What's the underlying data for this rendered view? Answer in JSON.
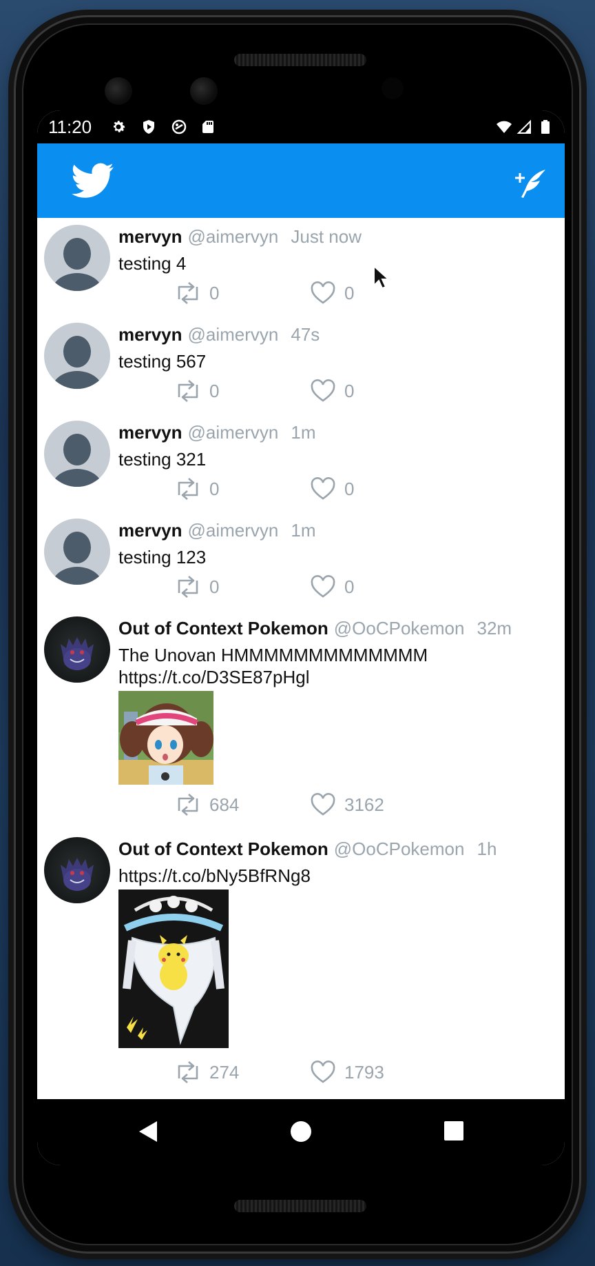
{
  "status_bar": {
    "time": "11:20",
    "left_icons": [
      "settings-icon",
      "shield-icon",
      "sync-icon",
      "sd-card-icon"
    ],
    "right_icons": [
      "wifi-icon",
      "signal-icon",
      "battery-icon"
    ]
  },
  "app_bar": {
    "logo": "twitter-bird-icon",
    "compose_icon": "compose-tweet-icon",
    "color": "#0a8ef0"
  },
  "tweets": [
    {
      "name": "mervyn",
      "handle": "@aimervyn",
      "time": "Just now",
      "text": "testing 4",
      "retweets": "0",
      "likes": "0",
      "avatar": "default"
    },
    {
      "name": "mervyn",
      "handle": "@aimervyn",
      "time": "47s",
      "text": "testing 567",
      "retweets": "0",
      "likes": "0",
      "avatar": "default"
    },
    {
      "name": "mervyn",
      "handle": "@aimervyn",
      "time": "1m",
      "text": "testing 321",
      "retweets": "0",
      "likes": "0",
      "avatar": "default"
    },
    {
      "name": "mervyn",
      "handle": "@aimervyn",
      "time": "1m",
      "text": "testing 123",
      "retweets": "0",
      "likes": "0",
      "avatar": "default"
    },
    {
      "name": "Out of Context Pokemon",
      "handle": "@OoCPokemon",
      "time": "32m",
      "text": "The Unovan HMMMMMMMMMMMMM\nhttps://t.co/D3SE87pHgl",
      "retweets": "684",
      "likes": "3162",
      "avatar": "gengar"
    },
    {
      "name": "Out of Context Pokemon",
      "handle": "@OoCPokemon",
      "time": "1h",
      "text": "https://t.co/bNy5BfRNg8",
      "retweets": "274",
      "likes": "1793",
      "avatar": "gengar"
    }
  ],
  "nav_bar": {
    "back": "back-triangle-icon",
    "home": "home-circle-icon",
    "recents": "recents-square-icon"
  }
}
